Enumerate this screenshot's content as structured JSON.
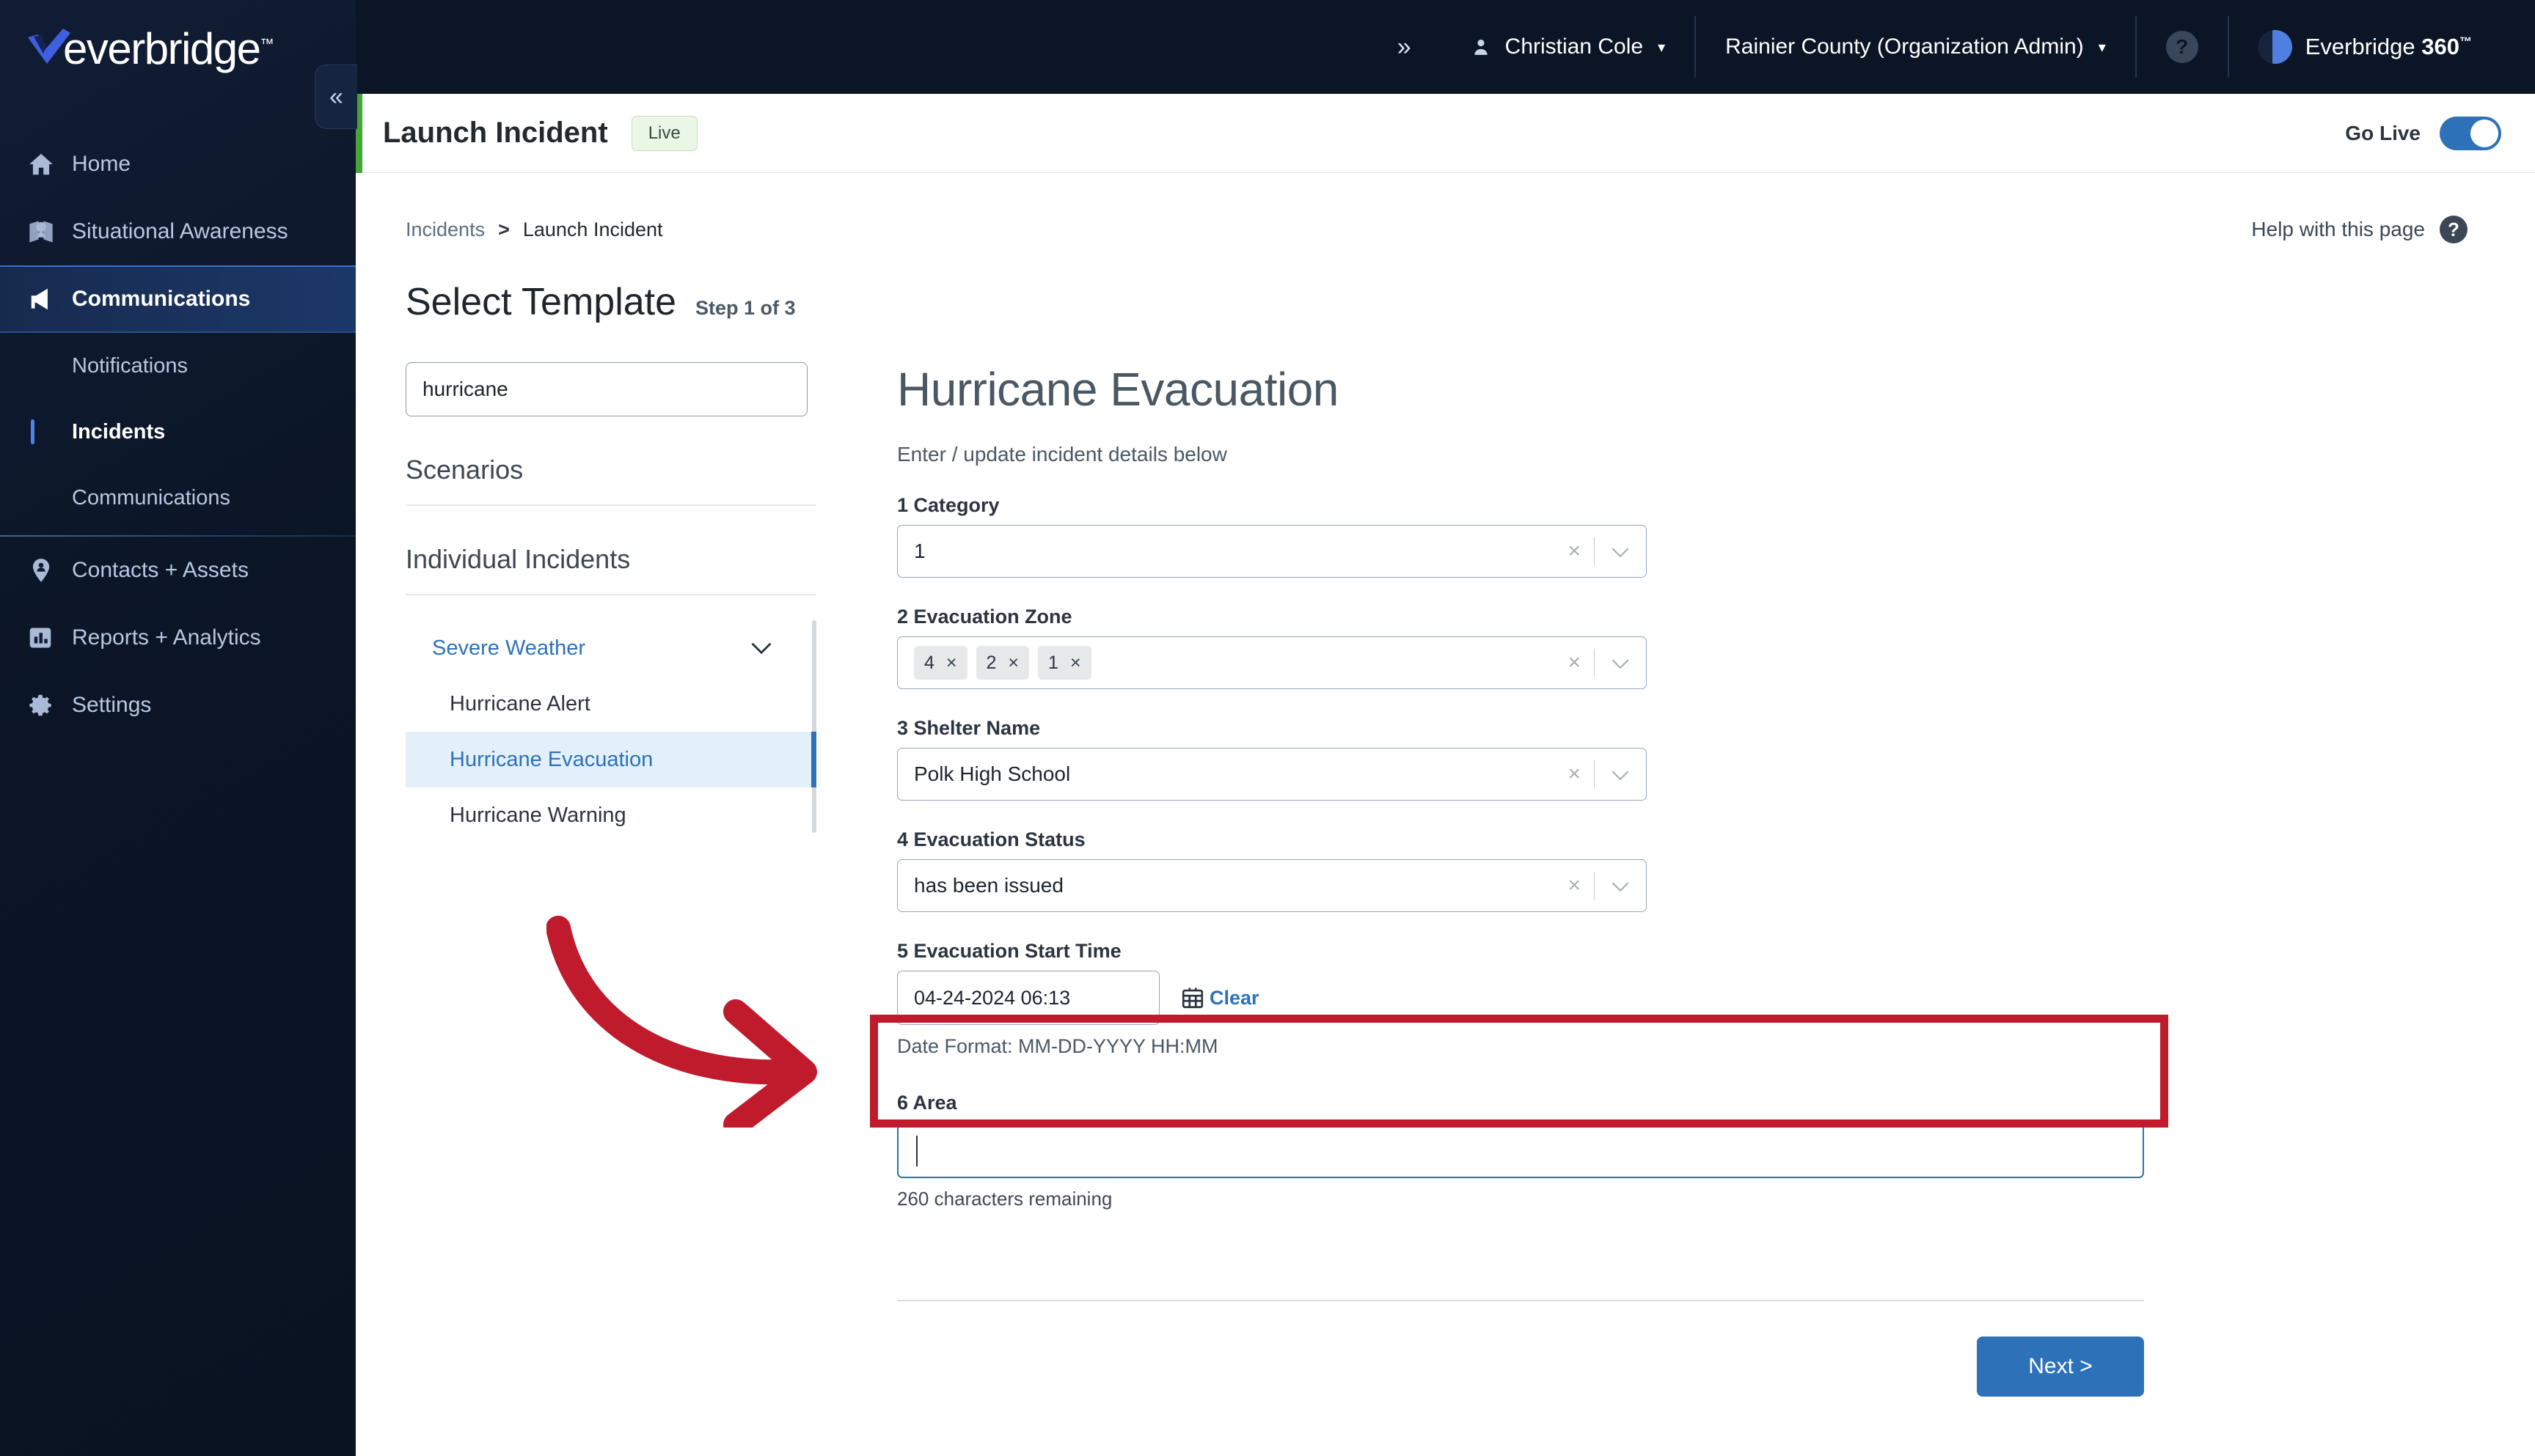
{
  "brand": {
    "logo_text": "everbridge",
    "logo_tm": "™"
  },
  "topbar": {
    "expand_icon": "»",
    "user_name": "Christian Cole",
    "user_caret": "▾",
    "org_name": "Rainier County (Organization Admin)",
    "org_caret": "▾",
    "help_icon_glyph": "?",
    "product_name_bold": "360",
    "product_name_light": "Everbridge ",
    "product_tm": "™"
  },
  "sidebar": {
    "collapse_icon": "«",
    "items": [
      {
        "label": "Home",
        "icon": "home-icon",
        "active": false
      },
      {
        "label": "Situational Awareness",
        "icon": "map-icon",
        "active": false
      },
      {
        "label": "Communications",
        "icon": "megaphone-icon",
        "active": true
      },
      {
        "label": "Contacts + Assets",
        "icon": "location-person-icon",
        "active": false
      },
      {
        "label": "Reports + Analytics",
        "icon": "bar-chart-icon",
        "active": false
      },
      {
        "label": "Settings",
        "icon": "gear-icon",
        "active": false
      }
    ],
    "sub_items": [
      {
        "label": "Notifications",
        "current": false
      },
      {
        "label": "Incidents",
        "current": true
      },
      {
        "label": "Communications",
        "current": false
      }
    ]
  },
  "page_header": {
    "title": "Launch Incident",
    "status_badge": "Live",
    "go_live_label": "Go Live",
    "go_live_on": true,
    "accent_color": "#45a638"
  },
  "breadcrumb": {
    "parent": "Incidents",
    "separator": ">",
    "current": "Launch Incident"
  },
  "help": {
    "label": "Help with this page",
    "icon_glyph": "?"
  },
  "section": {
    "title": "Select Template",
    "step": "Step 1 of 3"
  },
  "template_picker": {
    "search_value": "hurricane",
    "search_placeholder": "",
    "scenarios_title": "Scenarios",
    "individual_title": "Individual Incidents",
    "group": {
      "label": "Severe Weather",
      "chevron": "⌄",
      "expanded": true
    },
    "templates": [
      {
        "label": "Hurricane Alert",
        "selected": false
      },
      {
        "label": "Hurricane Evacuation",
        "selected": true
      },
      {
        "label": "Hurricane Warning",
        "selected": false
      }
    ]
  },
  "form": {
    "title": "Hurricane Evacuation",
    "subtitle": "Enter / update incident details below",
    "clear_glyph": "×",
    "chevron_glyph": "⌄",
    "fields": {
      "category": {
        "label": "1 Category",
        "value": "1"
      },
      "evacuation_zone": {
        "label": "2 Evacuation Zone",
        "chips": [
          "4",
          "2",
          "1"
        ],
        "chip_remove_glyph": "×"
      },
      "shelter_name": {
        "label": "3 Shelter Name",
        "value": "Polk High School"
      },
      "evacuation_status": {
        "label": "4 Evacuation Status",
        "value": "has been issued"
      },
      "evacuation_start_time": {
        "label": "5 Evacuation Start Time",
        "value": "04-24-2024 06:13",
        "clear_link": "Clear",
        "calendar_icon": "calendar-icon",
        "hint": "Date Format: MM-DD-YYYY HH:MM"
      },
      "area": {
        "label": "6 Area",
        "value": "",
        "placeholder": "",
        "chars_remaining": "260 characters remaining",
        "focused": true
      }
    },
    "next_button": "Next >"
  },
  "annotation": {
    "color": "#bf1b2c",
    "arrow": "curved-arrow-right",
    "highlight_target": "6 Area"
  }
}
